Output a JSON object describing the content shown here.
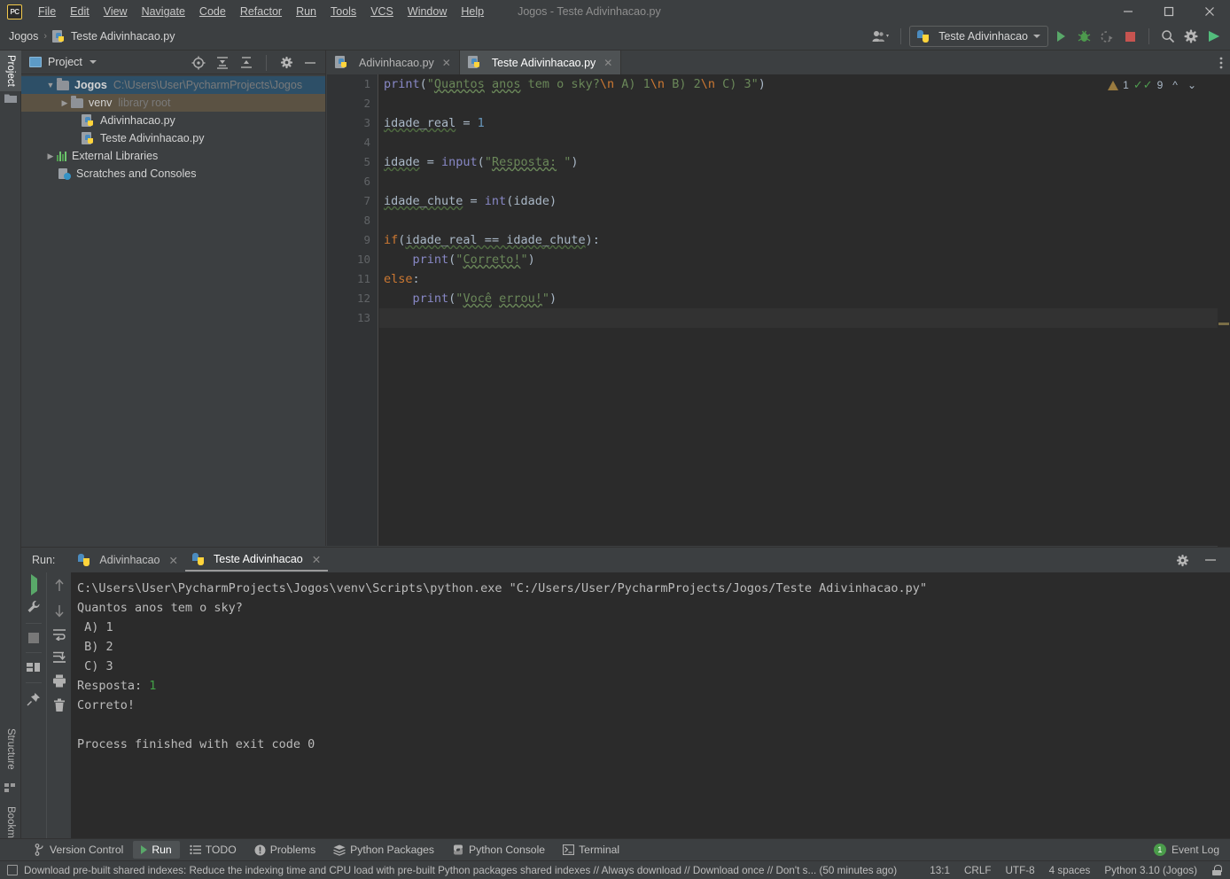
{
  "window": {
    "title": "Jogos - Teste Adivinhacao.py",
    "app_icon": "pycharm-logo-icon",
    "minimize_label": "—",
    "maximize_label": "□",
    "close_label": "✕"
  },
  "menu": [
    {
      "label": "File"
    },
    {
      "label": "Edit"
    },
    {
      "label": "View"
    },
    {
      "label": "Navigate"
    },
    {
      "label": "Code"
    },
    {
      "label": "Refactor"
    },
    {
      "label": "Run"
    },
    {
      "label": "Tools"
    },
    {
      "label": "VCS"
    },
    {
      "label": "Window"
    },
    {
      "label": "Help"
    }
  ],
  "breadcrumb": {
    "project": "Jogos",
    "separator": "›",
    "file": "Teste Adivinhacao.py"
  },
  "toolbar": {
    "account_icon": "user-account-icon",
    "run_config": "Teste Adivinhacao",
    "run_icon": "run-icon",
    "debug_icon": "debug-bug-icon",
    "coverage_icon": "run-with-coverage-icon",
    "stop_icon": "stop-icon",
    "search_icon": "search-everywhere-icon",
    "settings_icon": "settings-gear-icon",
    "updates_icon": "ide-updates-icon"
  },
  "left_strip": {
    "tabs": [
      {
        "label": "Project",
        "active": true
      },
      {
        "label": "Structure",
        "active": false
      },
      {
        "label": "Bookmarks",
        "active": false
      }
    ]
  },
  "project_panel": {
    "title": "Project",
    "tools": [
      {
        "name": "select-opened-file-icon"
      },
      {
        "name": "expand-all-icon"
      },
      {
        "name": "collapse-all-icon"
      },
      {
        "name": "settings-gear-icon"
      },
      {
        "name": "hide-panel-icon"
      }
    ],
    "tree": [
      {
        "label": "Jogos",
        "detail": "C:\\Users\\User\\PycharmProjects\\Jogos",
        "type": "folder",
        "expanded": true,
        "indent": 0,
        "selected": "blue"
      },
      {
        "label": "venv",
        "detail": "library root",
        "type": "folder",
        "expanded": false,
        "indent": 1,
        "selected": "tan"
      },
      {
        "label": "Adivinhacao.py",
        "detail": "",
        "type": "python",
        "indent": 2,
        "selected": "none"
      },
      {
        "label": "Teste Adivinhacao.py",
        "detail": "",
        "type": "python",
        "indent": 2,
        "selected": "none"
      },
      {
        "label": "External Libraries",
        "detail": "",
        "type": "library",
        "expanded": false,
        "indent": 0,
        "selected": "none"
      },
      {
        "label": "Scratches and Consoles",
        "detail": "",
        "type": "scratch",
        "indent": 1,
        "selected": "none"
      }
    ]
  },
  "editor": {
    "tabs": [
      {
        "label": "Adivinhacao.py",
        "active": false,
        "close": "✕"
      },
      {
        "label": "Teste Adivinhacao.py",
        "active": true,
        "close": "✕"
      }
    ],
    "more_icon": "more-options-icon",
    "inspections": {
      "warnings": "1",
      "warning_icon": "warning-triangle-icon",
      "checks": "9",
      "check_icon": "inspections-ok-icon",
      "prev_icon": "previous-highlight-icon",
      "next_icon": "next-highlight-icon"
    },
    "line_numbers": [
      "1",
      "2",
      "3",
      "4",
      "5",
      "6",
      "7",
      "8",
      "9",
      "10",
      "11",
      "12",
      "13"
    ],
    "code": [
      "print(\"Quantos anos tem o sky?\\n A) 1\\n B) 2\\n C) 3\")",
      "",
      "idade_real = 1",
      "",
      "idade = input(\"Resposta: \")",
      "",
      "idade_chute = int(idade)",
      "",
      "if(idade_real == idade_chute):",
      "    print(\"Correto!\")",
      "else:",
      "    print(\"Você errou!\")",
      ""
    ],
    "caret_line": 13
  },
  "run_panel": {
    "label": "Run:",
    "tabs": [
      {
        "label": "Adivinhacao",
        "active": false,
        "close": "✕"
      },
      {
        "label": "Teste Adivinhacao",
        "active": true,
        "close": "✕"
      }
    ],
    "header_tools": [
      {
        "name": "settings-gear-icon"
      },
      {
        "name": "hide-panel-icon"
      }
    ],
    "left_tools": [
      {
        "name": "rerun-icon"
      },
      {
        "name": "edit-configuration-wrench-icon"
      },
      {
        "name": "stop-icon"
      },
      {
        "name": "layout-icon"
      },
      {
        "name": "pin-tab-icon"
      }
    ],
    "right_tools": [
      {
        "name": "up-arrow-icon"
      },
      {
        "name": "down-arrow-icon"
      },
      {
        "name": "soft-wrap-icon"
      },
      {
        "name": "scroll-to-end-icon"
      },
      {
        "name": "print-icon"
      },
      {
        "name": "clear-all-trash-icon"
      }
    ],
    "console": [
      {
        "text": "C:\\Users\\User\\PycharmProjects\\Jogos\\venv\\Scripts\\python.exe \"C:/Users/User/PycharmProjects/Jogos/Teste Adivinhacao.py\"",
        "style": "normal"
      },
      {
        "text": "Quantos anos tem o sky?",
        "style": "normal"
      },
      {
        "text": " A) 1",
        "style": "normal"
      },
      {
        "text": " B) 2",
        "style": "normal"
      },
      {
        "text": " C) 3",
        "style": "normal"
      },
      {
        "text": "Resposta: ",
        "style": "normal",
        "input": "1"
      },
      {
        "text": "Correto!",
        "style": "normal"
      },
      {
        "text": "",
        "style": "normal"
      },
      {
        "text": "Process finished with exit code 0",
        "style": "normal"
      }
    ]
  },
  "bottom_tabs": [
    {
      "label": "Version Control",
      "icon": "branch-icon",
      "active": false
    },
    {
      "label": "Run",
      "icon": "run-icon",
      "active": true
    },
    {
      "label": "TODO",
      "icon": "todo-list-icon",
      "active": false
    },
    {
      "label": "Problems",
      "icon": "problems-icon",
      "active": false
    },
    {
      "label": "Python Packages",
      "icon": "packages-icon",
      "active": false
    },
    {
      "label": "Python Console",
      "icon": "python-console-icon",
      "active": false
    },
    {
      "label": "Terminal",
      "icon": "terminal-icon",
      "active": false
    }
  ],
  "event_log": {
    "label": "Event Log",
    "count": "1"
  },
  "status_bar": {
    "message": "Download pre-built shared indexes: Reduce the indexing time and CPU load with pre-built Python packages shared indexes // Always download // Download once // Don't s... (50 minutes ago)",
    "message_icon": "notification-icon",
    "caret_position": "13:1",
    "line_separator": "CRLF",
    "encoding": "UTF-8",
    "indent": "4 spaces",
    "interpreter": "Python 3.10 (Jogos)",
    "lock_icon": "read-only-lock-icon"
  },
  "colors": {
    "bg_panel": "#3c3f41",
    "bg_editor": "#2b2b2b",
    "accent_green": "#59a869",
    "accent_red": "#c75450",
    "keyword": "#cc7832",
    "string": "#6a8759",
    "number": "#6897bb",
    "function": "#8888c6",
    "plain": "#a9b7c6",
    "selection_blue": "#2d4f67",
    "selection_tan": "#5b5243"
  }
}
